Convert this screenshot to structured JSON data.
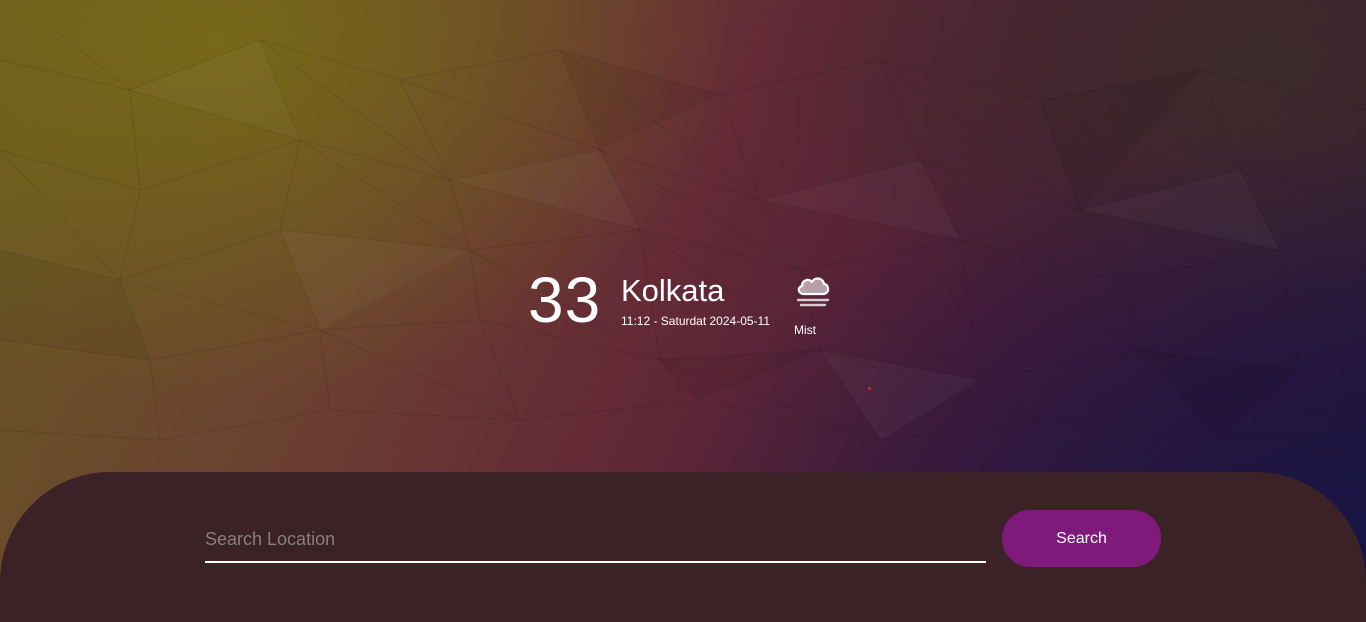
{
  "weather": {
    "temperature": "33",
    "city": "Kolkata",
    "datetime": "11:12 - Saturdat 2024-05-11",
    "condition": "Mist",
    "condition_icon": "mist-cloud-icon"
  },
  "search": {
    "placeholder": "Search Location",
    "value": "",
    "button_label": "Search"
  },
  "colors": {
    "button": "#7f1a7b",
    "panel": "#3a2226",
    "text": "#ffffff"
  }
}
